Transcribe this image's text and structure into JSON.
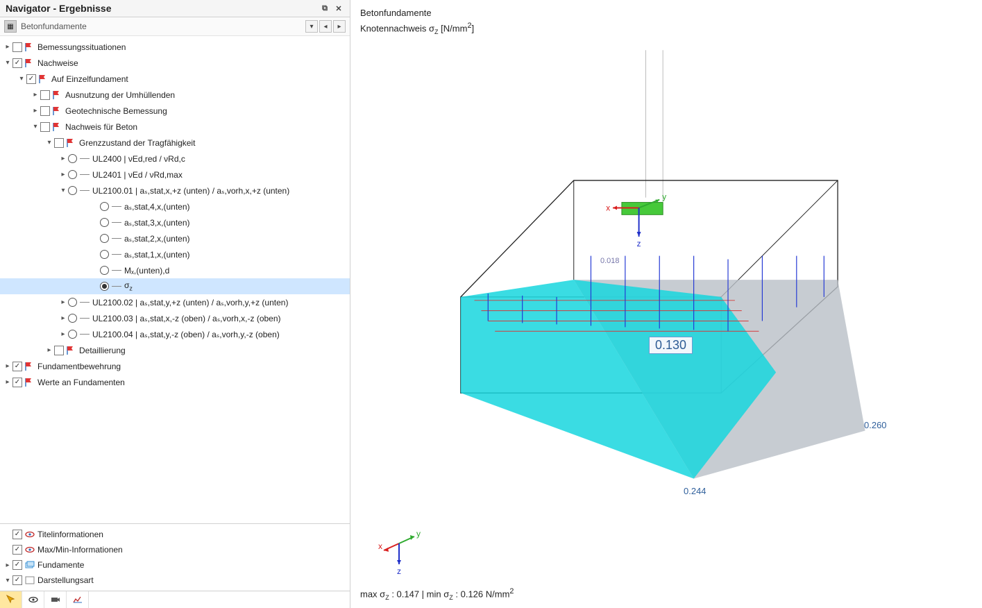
{
  "panel": {
    "title": "Navigator - Ergebnisse",
    "breadcrumb": "Betonfundamente"
  },
  "tree": {
    "bemessung": "Bemessungssituationen",
    "nachweise": "Nachweise",
    "einzel": "Auf Einzelfundament",
    "ausnutzung": "Ausnutzung der Umhüllenden",
    "geotech": "Geotechnische Bemessung",
    "beton": "Nachweis für Beton",
    "grenz": "Grenzzustand der Tragfähigkeit",
    "ul2400": "UL2400 | νEd,red / νRd,c",
    "ul2401": "UL2401 | νEd / νRd,max",
    "ul2100_01": "UL2100.01 | aₛ,stat,x,+z (unten) / aₛ,vorh,x,+z (unten)",
    "a4": "aₛ,stat,4,x,(unten)",
    "a3": "aₛ,stat,3,x,(unten)",
    "a2": "aₛ,stat,2,x,(unten)",
    "a1": "aₛ,stat,1,x,(unten)",
    "mx": "Mₓ,(unten),d",
    "sigz": "σz",
    "ul2100_02": "UL2100.02 | aₛ,stat,y,+z (unten) / aₛ,vorh,y,+z (unten)",
    "ul2100_03": "UL2100.03 | aₛ,stat,x,-z (oben) / aₛ,vorh,x,-z (oben)",
    "ul2100_04": "UL2100.04 | aₛ,stat,y,-z (oben) / aₛ,vorh,y,-z (oben)",
    "detail": "Detaillierung",
    "fundbew": "Fundamentbewehrung",
    "werte": "Werte an Fundamenten"
  },
  "bottom": {
    "titel": "Titelinformationen",
    "maxmin": "Max/Min-Informationen",
    "fund": "Fundamente",
    "darst": "Darstellungsart"
  },
  "viewport": {
    "title_l1": "Betonfundamente",
    "title_l2_a": "Knotennachweis σ",
    "title_l2_sub": "Z",
    "title_l2_b": " [N/mm",
    "title_l2_sup": "2",
    "title_l2_c": "]",
    "footer_a": "max σ",
    "footer_sub": "Z",
    "footer_b": " : 0.147 | min σ",
    "footer_c": " : 0.126 N/mm",
    "value_near": "0.018",
    "value_box": "0.130",
    "value_far1": "0.260",
    "value_far2": "0.244",
    "triad_x": "x",
    "triad_y": "y",
    "triad_z": "z",
    "axis_x": "x",
    "axis_y": "y",
    "axis_z": "z"
  }
}
